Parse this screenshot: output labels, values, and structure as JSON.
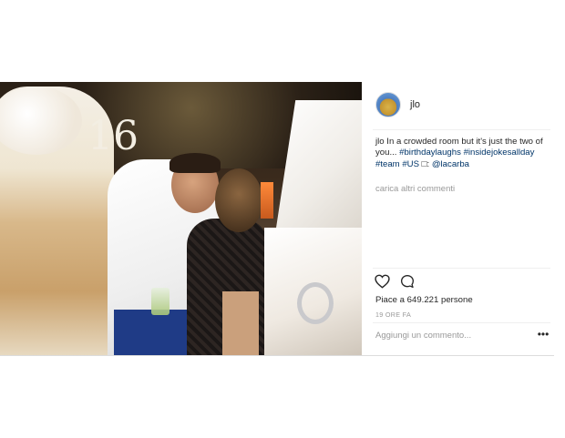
{
  "post": {
    "username": "jlo",
    "caption": {
      "username": "jlo",
      "text_parts": [
        {
          "t": " In a crowded room but it's just the two of you... ",
          "kind": "text"
        },
        {
          "t": "#birthdaylaughs",
          "kind": "hashtag"
        },
        {
          "t": " ",
          "kind": "text"
        },
        {
          "t": "#insidejokesallday",
          "kind": "hashtag"
        },
        {
          "t": " ",
          "kind": "text"
        },
        {
          "t": "#team",
          "kind": "hashtag"
        },
        {
          "t": " ",
          "kind": "text"
        },
        {
          "t": "#US",
          "kind": "hashtag"
        },
        {
          "t": " □: ",
          "kind": "text"
        },
        {
          "t": "@lacarba",
          "kind": "mention"
        }
      ]
    },
    "load_more_comments": "carica altri commenti",
    "likes": "Piace a 649.221 persone",
    "time": "19 ORE FA",
    "comment_placeholder": "Aggiungi un commento...",
    "more_label": "•••",
    "photo_topper_text": "16"
  },
  "icons": {
    "like": "heart-icon",
    "comment": "comment-bubble-icon",
    "more": "more-options-icon"
  },
  "colors": {
    "text": "#262626",
    "muted": "#999999",
    "link": "#003569",
    "divider": "#efefef"
  }
}
